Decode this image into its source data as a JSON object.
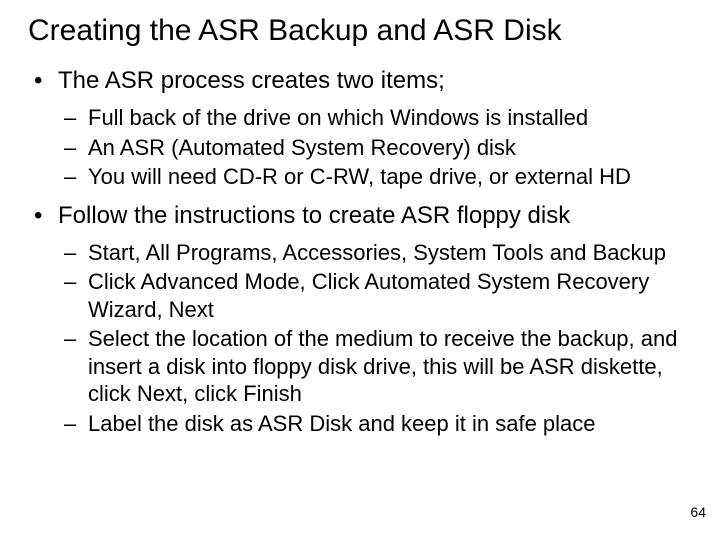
{
  "title": "Creating the ASR Backup and ASR Disk",
  "bullets": [
    {
      "text": "The ASR process creates two items;",
      "sub": [
        "Full back of the drive on which Windows is installed",
        "An ASR (Automated System Recovery) disk",
        "You will need CD-R or C-RW, tape drive, or external HD"
      ]
    },
    {
      "text": "Follow the instructions to create ASR floppy disk",
      "sub": [
        "Start, All Programs, Accessories, System Tools and Backup",
        "Click Advanced Mode, Click Automated System Recovery Wizard, Next",
        "Select the location of the medium to receive the backup, and insert a disk into floppy disk drive, this will be ASR diskette, click Next, click Finish",
        "Label the disk as ASR Disk and keep it in safe place"
      ]
    }
  ],
  "page_number": "64"
}
